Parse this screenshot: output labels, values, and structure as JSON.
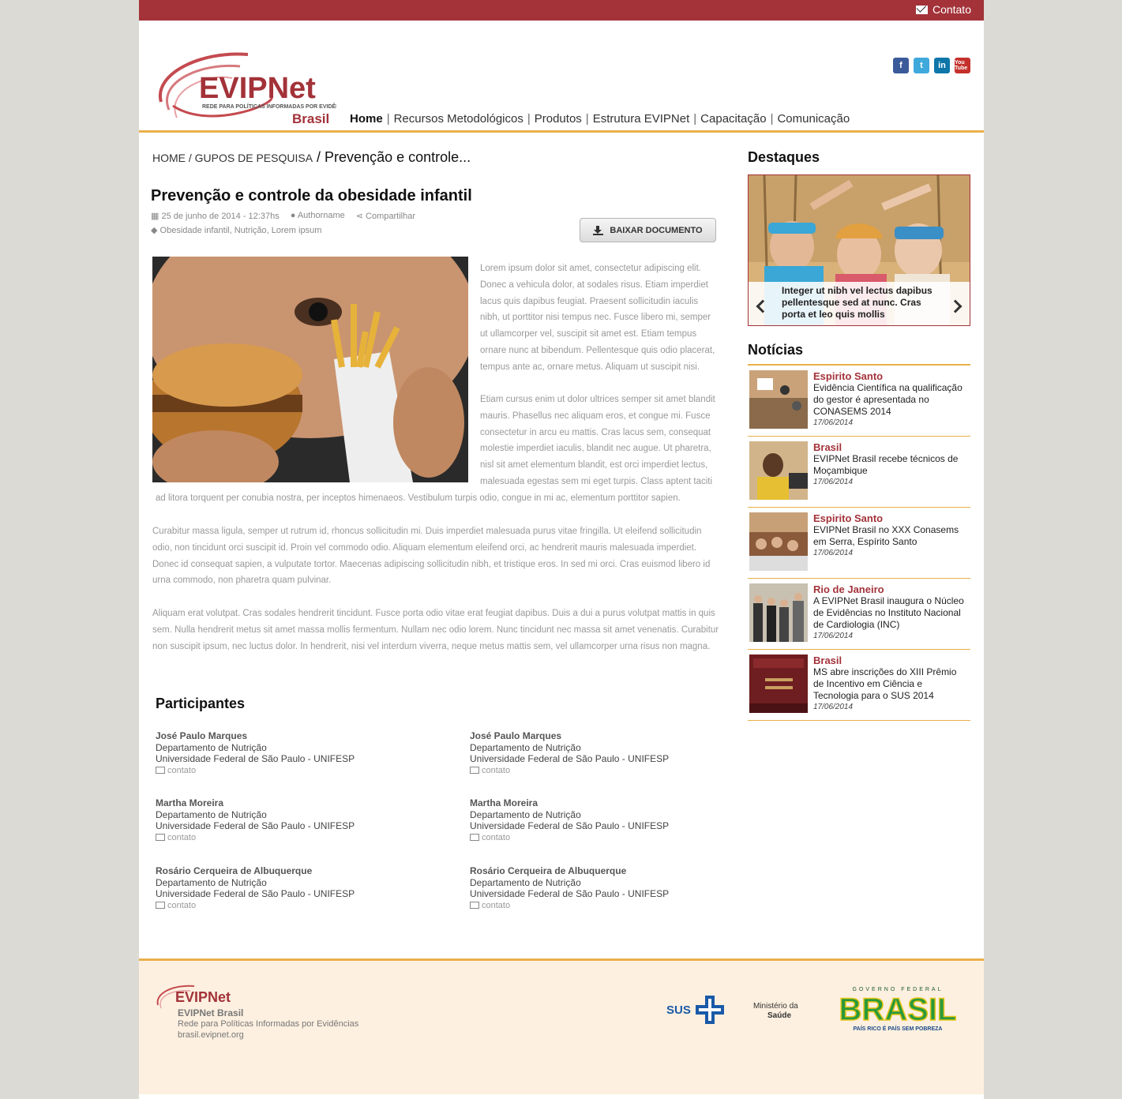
{
  "topbar": {
    "contact_label": "Contato"
  },
  "brand": {
    "name": "EVIPNet",
    "tagline": "REDE PARA POLÍTICAS INFORMADAS POR EVIDÊNCIAS",
    "country": "Brasil"
  },
  "nav": [
    {
      "label": "Home"
    },
    {
      "label": "Recursos Metodológicos"
    },
    {
      "label": "Produtos"
    },
    {
      "label": "Estrutura EVIPNet"
    },
    {
      "label": "Capacitação"
    },
    {
      "label": "Comunicação"
    }
  ],
  "social": {
    "facebook": "f",
    "twitter": "t",
    "linkedin": "in",
    "youtube": "You Tube"
  },
  "breadcrumb": {
    "home": "HOME",
    "sep": " / ",
    "group": "GUPOS DE PESQUISA",
    "current": " / Prevenção e controle..."
  },
  "article": {
    "title": "Prevenção e controle da obesidade infantil",
    "date": "25 de junho de 2014 - 12:37hs",
    "author": "Authorname",
    "share": "Compartilhar",
    "tags": "Obesidade infantil, Nutrição, Lorem ipsum",
    "download_label": "BAIXAR DOCUMENTO",
    "para1": "Lorem ipsum dolor sit amet, consectetur adipiscing elit. Donec a vehicula dolor, at sodales risus. Etiam imperdiet lacus quis dapibus feugiat. Praesent sollicitudin iaculis nibh, ut porttitor nisi tempus nec. Fusce libero mi, semper ut ullamcorper vel, suscipit sit amet est. Etiam tempus ornare nunc at bibendum. Pellentesque quis odio placerat, tempus ante ac, ornare metus. Aliquam ut suscipit nisi.",
    "para2a": "Etiam cursus enim ut dolor ultrices semper sit amet blandit mauris. Phasellus nec aliquam eros, et congue mi. Fusce consectetur in arcu eu mattis. Cras lacus sem, consequat molestie imperdiet iaculis, blandit nec augue. Ut pharetra, nisl sit amet elementum blandit, est orci imperdiet lectus, malesuada egestas sem mi eget turpis. Class aptent taciti",
    "para2b": "ad litora torquent per conubia nostra, per inceptos himenaeos. Vestibulum turpis odio, congue in mi ac, elementum porttitor sapien.",
    "para3": "Curabitur massa ligula, semper ut rutrum id, rhoncus sollicitudin mi. Duis imperdiet malesuada purus vitae fringilla. Ut eleifend sollicitudin odio, non tincidunt orci suscipit id. Proin vel commodo odio. Aliquam elementum eleifend orci, ac hendrerit mauris malesuada imperdiet. Donec id consequat sapien, a vulputate tortor. Maecenas adipiscing sollicitudin nibh, et tristique eros. In sed mi orci. Cras euismod libero id urna commodo, non pharetra quam pulvinar.",
    "para4": "Aliquam erat volutpat. Cras sodales hendrerit tincidunt. Fusce porta odio vitae erat feugiat dapibus. Duis a dui a purus volutpat mattis in quis sem. Nulla hendrerit metus sit amet massa mollis fermentum. Nullam nec odio lorem. Nunc tincidunt nec massa sit amet venenatis. Curabitur non suscipit ipsum, nec luctus dolor. In hendrerit, nisi vel interdum viverra, neque metus mattis sem, vel ullamcorper urna risus non magna."
  },
  "participants": {
    "heading": "Participantes",
    "items": [
      {
        "name": "José Paulo Marques",
        "dept": "Departamento de Nutrição",
        "inst": "Universidade Federal de São Paulo - UNIFESP",
        "contact": "contato"
      },
      {
        "name": "José Paulo Marques",
        "dept": "Departamento de Nutrição",
        "inst": "Universidade Federal de São Paulo - UNIFESP",
        "contact": "contato"
      },
      {
        "name": "Martha Moreira",
        "dept": "Departamento de Nutrição",
        "inst": "Universidade Federal de São Paulo - UNIFESP",
        "contact": "contato"
      },
      {
        "name": "Martha Moreira",
        "dept": "Departamento de Nutrição",
        "inst": "Universidade Federal de São Paulo - UNIFESP",
        "contact": "contato"
      },
      {
        "name": "Rosário Cerqueira de Albuquerque",
        "dept": "Departamento de Nutrição",
        "inst": "Universidade Federal de São Paulo - UNIFESP",
        "contact": "contato"
      },
      {
        "name": "Rosário Cerqueira de Albuquerque",
        "dept": "Departamento de Nutrição",
        "inst": "Universidade Federal de São Paulo - UNIFESP",
        "contact": "contato"
      }
    ]
  },
  "sidebar": {
    "destaques_heading": "Destaques",
    "destaque_caption": "Integer ut nibh vel lectus dapibus pellentesque sed at nunc. Cras porta et leo quis mollis",
    "noticias_heading": "Notícias",
    "news": [
      {
        "loc": "Espirito Santo",
        "title": "Evidência Científica na qualificação do gestor é apresentada no CONASEMS 2014",
        "date": "17/06/2014"
      },
      {
        "loc": "Brasil",
        "title": "EVIPNet Brasil recebe técnicos de Moçambique",
        "date": "17/06/2014"
      },
      {
        "loc": "Espirito Santo",
        "title": "EVIPNet Brasil no XXX Conasems em Serra, Espírito Santo",
        "date": "17/06/2014"
      },
      {
        "loc": "Rio de Janeiro",
        "title": "A EVIPNet Brasil inaugura o Núcleo de Evidências no Instituto Nacional de Cardiologia (INC)",
        "date": "17/06/2014"
      },
      {
        "loc": "Brasil",
        "title": "MS abre inscrições do XIII Prêmio de Incentivo em Ciência e Tecnologia para o SUS 2014",
        "date": "17/06/2014"
      }
    ]
  },
  "footer": {
    "name": "EVIPNet Brasil",
    "subtitle": "Rede para Políticas Informadas por Evidências",
    "url": "brasil.evipnet.org",
    "sus": "SUS",
    "ministry_1": "Ministério da",
    "ministry_2": "Saúde",
    "gov_top": "GOVERNO FEDERAL",
    "gov_main": "BRASIL",
    "gov_bottom": "PAÍS RICO É PAÍS SEM POBREZA"
  },
  "colors": {
    "brand_red": "#a33239",
    "accent_gold": "#eab04b",
    "footer_bg": "#fdf0e0"
  }
}
